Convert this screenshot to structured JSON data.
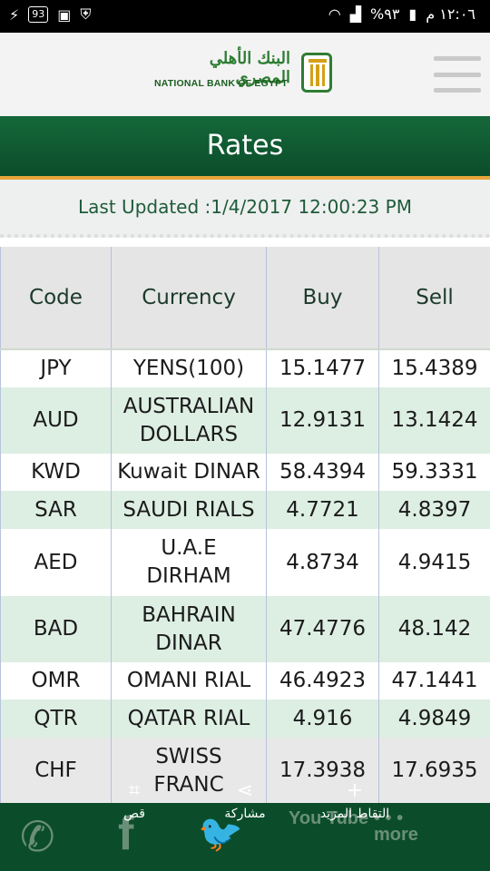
{
  "status_bar": {
    "time": "١٢:٠٦ م",
    "battery": "%٩٣",
    "battery_box": "93"
  },
  "header": {
    "logo_arabic": "البنك الأهلي المصري",
    "logo_english": "NATIONAL BANK OF EGYPT"
  },
  "title": "Rates",
  "last_updated": "Last Updated :1/4/2017 12:00:23 PM",
  "table": {
    "columns": [
      "Code",
      "Currency",
      "Buy",
      "Sell"
    ],
    "rows": [
      {
        "code": "JPY",
        "currency_line1": "YENS(100)",
        "currency_line2": "",
        "buy": "15.1477",
        "sell": "15.4389"
      },
      {
        "code": "AUD",
        "currency_line1": "AUSTRALIAN",
        "currency_line2": "DOLLARS",
        "buy": "12.9131",
        "sell": "13.1424"
      },
      {
        "code": "KWD",
        "currency_line1": "Kuwait DINAR",
        "currency_line2": "",
        "buy": "58.4394",
        "sell": "59.3331"
      },
      {
        "code": "SAR",
        "currency_line1": "SAUDI RIALS",
        "currency_line2": "",
        "buy": "4.7721",
        "sell": "4.8397"
      },
      {
        "code": "AED",
        "currency_line1": "U.A.E",
        "currency_line2": "DIRHAM",
        "buy": "4.8734",
        "sell": "4.9415"
      },
      {
        "code": "BAD",
        "currency_line1": "BAHRAIN",
        "currency_line2": "DINAR",
        "buy": "47.4776",
        "sell": "48.142"
      },
      {
        "code": "OMR",
        "currency_line1": "OMANI RIAL",
        "currency_line2": "",
        "buy": "46.4923",
        "sell": "47.1441"
      },
      {
        "code": "QTR",
        "currency_line1": "QATAR RIAL",
        "currency_line2": "",
        "buy": "4.916",
        "sell": "4.9849"
      },
      {
        "code": "CHF",
        "currency_line1": "SWISS",
        "currency_line2": "FRANC",
        "buy": "17.3938",
        "sell": "17.6935"
      }
    ]
  },
  "overlay_actions": {
    "crop": "قص",
    "share": "مشاركة",
    "more_captures": "التقاط المزيد"
  },
  "bottom_bar": {
    "youtube_label": "You Tube",
    "more_label": "more"
  },
  "icons": [
    "phone-icon",
    "facebook-icon",
    "twitter-icon",
    "youtube-icon",
    "more-dots-icon",
    "crop-icon",
    "share-icon",
    "plus-icon",
    "wifi-icon",
    "signal-icon",
    "battery-icon"
  ],
  "colors": {
    "brand_green": "#0b4d2a",
    "accent_orange": "#e8a43a",
    "row_green": "#ddeee3"
  }
}
